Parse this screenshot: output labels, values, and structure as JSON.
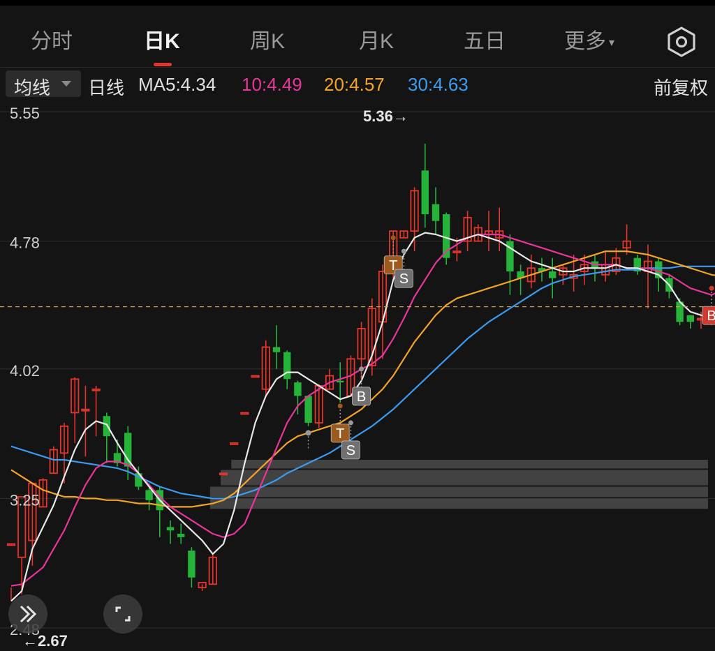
{
  "tabs": [
    {
      "label": "分时",
      "active": false
    },
    {
      "label": "日K",
      "active": true
    },
    {
      "label": "周K",
      "active": false
    },
    {
      "label": "月K",
      "active": false
    },
    {
      "label": "五日",
      "active": false
    },
    {
      "label": "更多",
      "active": false
    }
  ],
  "more_caret": "▾",
  "icons": {
    "settings": "hexagon-gear-icon",
    "expand": "double-chevron-right-icon",
    "fullscreen": "fullscreen-corners-icon"
  },
  "ma_bar": {
    "selector_label": "均线",
    "period_label": "日线",
    "ma5": "MA5:4.34",
    "ma10": "10:4.49",
    "ma20": "20:4.57",
    "ma30": "30:4.63",
    "adjust_label": "前复权"
  },
  "colors": {
    "up": "#e5362b",
    "down": "#25b339",
    "ma5": "#e8e8e8",
    "ma10": "#e8359a",
    "ma20": "#f3a426",
    "ma30": "#3a9bef",
    "current_price_line": "#c9a24a",
    "marker_T": "#9c5a1e",
    "marker_S": "#707070",
    "marker_B_gray": "#707070",
    "marker_B_red": "#d23a30"
  },
  "chart_data": {
    "type": "candlestick",
    "y_axis_labels": [
      "5.55",
      "4.78",
      "4.02",
      "3.25",
      "2.48"
    ],
    "ylim": [
      2.48,
      5.55
    ],
    "high_label": "5.36→",
    "low_label": "←2.67",
    "high_value": 5.36,
    "low_value": 2.67,
    "current_price": 4.39,
    "candles": [
      [
        2.98,
        2.98,
        2.72,
        2.64
      ],
      [
        2.9,
        3.26,
        2.68,
        2.9
      ],
      [
        3.0,
        3.34,
        2.85,
        3.34
      ],
      [
        3.2,
        3.36,
        3.2,
        3.37
      ],
      [
        3.4,
        3.54,
        3.4,
        3.56
      ],
      [
        3.52,
        3.68,
        3.34,
        3.7
      ],
      [
        3.76,
        3.96,
        3.58,
        3.97
      ],
      [
        3.78,
        3.78,
        3.5,
        3.92
      ],
      [
        3.9,
        3.9,
        3.62,
        3.92
      ],
      [
        3.74,
        3.62,
        3.46,
        3.76
      ],
      [
        3.52,
        3.46,
        3.44,
        3.6
      ],
      [
        3.64,
        3.44,
        3.36,
        3.68
      ],
      [
        3.4,
        3.32,
        3.3,
        3.44
      ],
      [
        3.3,
        3.24,
        3.18,
        3.34
      ],
      [
        3.3,
        3.18,
        3.02,
        3.32
      ],
      [
        3.08,
        3.06,
        2.98,
        3.12
      ],
      [
        3.04,
        3.02,
        2.98,
        3.1
      ],
      [
        2.94,
        2.78,
        2.72,
        2.96
      ],
      [
        2.72,
        2.75,
        2.7,
        2.74
      ],
      [
        2.74,
        2.9,
        2.74,
        2.92
      ],
      [
        3.4,
        3.4,
        3.4,
        3.4
      ],
      [
        3.58,
        3.58,
        3.58,
        3.58
      ],
      [
        3.76,
        3.76,
        3.76,
        3.76
      ],
      [
        3.98,
        3.98,
        3.98,
        3.98
      ],
      [
        3.9,
        4.15,
        3.86,
        4.19
      ],
      [
        4.15,
        4.12,
        4.02,
        4.28
      ],
      [
        4.12,
        3.96,
        3.9,
        4.13
      ],
      [
        3.94,
        3.86,
        3.75,
        3.95
      ],
      [
        3.86,
        3.7,
        3.68,
        3.86
      ],
      [
        3.7,
        3.92,
        3.67,
        3.93
      ],
      [
        3.9,
        3.98,
        3.9,
        4.02
      ],
      [
        3.95,
        3.94,
        3.82,
        4.06
      ],
      [
        3.86,
        4.08,
        3.86,
        4.1
      ],
      [
        4.08,
        4.26,
        3.96,
        4.3
      ],
      [
        4.04,
        4.38,
        3.98,
        4.44
      ],
      [
        4.3,
        4.6,
        4.08,
        4.64
      ],
      [
        4.6,
        4.84,
        4.56,
        4.84
      ],
      [
        4.8,
        4.84,
        4.8,
        4.84
      ],
      [
        4.84,
        5.08,
        4.72,
        5.1
      ],
      [
        5.2,
        4.94,
        4.86,
        5.36
      ],
      [
        5.0,
        4.9,
        4.82,
        5.1
      ],
      [
        4.94,
        4.68,
        4.64,
        4.95
      ],
      [
        4.72,
        4.72,
        4.66,
        4.8
      ],
      [
        4.78,
        4.92,
        4.72,
        4.96
      ],
      [
        4.78,
        4.86,
        4.78,
        4.88
      ],
      [
        4.82,
        4.84,
        4.72,
        4.96
      ],
      [
        4.8,
        4.84,
        4.72,
        4.98
      ],
      [
        4.78,
        4.6,
        4.46,
        4.82
      ],
      [
        4.6,
        4.56,
        4.46,
        4.64
      ],
      [
        4.54,
        4.62,
        4.5,
        4.7
      ],
      [
        4.62,
        4.6,
        4.54,
        4.68
      ],
      [
        4.6,
        4.56,
        4.44,
        4.68
      ],
      [
        4.58,
        4.62,
        4.52,
        4.64
      ],
      [
        4.56,
        4.58,
        4.48,
        4.7
      ],
      [
        4.6,
        4.64,
        4.52,
        4.7
      ],
      [
        4.66,
        4.62,
        4.54,
        4.7
      ],
      [
        4.58,
        4.64,
        4.54,
        4.72
      ],
      [
        4.6,
        4.68,
        4.58,
        4.74
      ],
      [
        4.74,
        4.78,
        4.7,
        4.88
      ],
      [
        4.68,
        4.6,
        4.58,
        4.7
      ],
      [
        4.6,
        4.66,
        4.38,
        4.76
      ],
      [
        4.66,
        4.56,
        4.48,
        4.68
      ],
      [
        4.56,
        4.48,
        4.44,
        4.58
      ],
      [
        4.42,
        4.3,
        4.28,
        4.44
      ],
      [
        4.34,
        4.3,
        4.26,
        4.34
      ],
      [
        4.32,
        4.32,
        4.26,
        4.36
      ],
      [
        4.3,
        4.34,
        4.28,
        4.36
      ],
      [
        4.28,
        4.34,
        4.24,
        4.44
      ]
    ],
    "ma5": [
      2.64,
      2.7,
      2.95,
      3.08,
      3.21,
      3.38,
      3.54,
      3.66,
      3.71,
      3.69,
      3.58,
      3.48,
      3.4,
      3.32,
      3.24,
      3.18,
      3.12,
      3.06,
      3.0,
      2.92,
      2.98,
      3.18,
      3.46,
      3.7,
      3.86,
      3.96,
      4.0,
      4.0,
      3.96,
      3.92,
      3.88,
      3.84,
      3.86,
      3.95,
      4.1,
      4.3,
      4.55,
      4.7,
      4.8,
      4.83,
      4.82,
      4.8,
      4.78,
      4.8,
      4.82,
      4.8,
      4.78,
      4.74,
      4.7,
      4.66,
      4.64,
      4.62,
      4.6,
      4.6,
      4.62,
      4.62,
      4.62,
      4.64,
      4.62,
      4.62,
      4.6,
      4.58,
      4.52,
      4.42,
      4.36,
      4.34,
      4.32,
      4.34
    ],
    "ma10": [
      2.73,
      2.74,
      2.79,
      2.84,
      2.95,
      3.06,
      3.2,
      3.33,
      3.43,
      3.47,
      3.47,
      3.45,
      3.4,
      3.33,
      3.26,
      3.2,
      3.16,
      3.12,
      3.08,
      3.04,
      3.02,
      3.04,
      3.1,
      3.25,
      3.4,
      3.55,
      3.7,
      3.8,
      3.86,
      3.9,
      3.94,
      3.96,
      3.98,
      4.02,
      4.05,
      4.1,
      4.2,
      4.32,
      4.45,
      4.55,
      4.65,
      4.72,
      4.76,
      4.8,
      4.82,
      4.82,
      4.82,
      4.8,
      4.78,
      4.76,
      4.74,
      4.72,
      4.7,
      4.68,
      4.66,
      4.64,
      4.64,
      4.64,
      4.62,
      4.62,
      4.62,
      4.6,
      4.58,
      4.54,
      4.5,
      4.48,
      4.46,
      4.49
    ],
    "ma20": [
      3.42,
      3.38,
      3.34,
      3.3,
      3.28,
      3.26,
      3.26,
      3.25,
      3.25,
      3.24,
      3.24,
      3.23,
      3.22,
      3.22,
      3.21,
      3.2,
      3.2,
      3.2,
      3.21,
      3.22,
      3.24,
      3.28,
      3.34,
      3.4,
      3.46,
      3.52,
      3.58,
      3.62,
      3.64,
      3.66,
      3.68,
      3.7,
      3.74,
      3.78,
      3.84,
      3.9,
      3.98,
      4.08,
      4.18,
      4.26,
      4.34,
      4.4,
      4.44,
      4.46,
      4.48,
      4.5,
      4.52,
      4.54,
      4.56,
      4.58,
      4.6,
      4.62,
      4.64,
      4.66,
      4.68,
      4.7,
      4.72,
      4.72,
      4.72,
      4.71,
      4.7,
      4.68,
      4.66,
      4.64,
      4.62,
      4.6,
      4.58,
      4.57
    ],
    "ma30": [
      3.56,
      3.54,
      3.52,
      3.5,
      3.48,
      3.48,
      3.47,
      3.46,
      3.45,
      3.44,
      3.43,
      3.41,
      3.38,
      3.35,
      3.32,
      3.3,
      3.28,
      3.27,
      3.26,
      3.25,
      3.25,
      3.26,
      3.28,
      3.3,
      3.33,
      3.36,
      3.4,
      3.43,
      3.46,
      3.49,
      3.52,
      3.56,
      3.6,
      3.64,
      3.68,
      3.73,
      3.78,
      3.84,
      3.9,
      3.96,
      4.02,
      4.08,
      4.14,
      4.2,
      4.25,
      4.3,
      4.34,
      4.38,
      4.42,
      4.46,
      4.5,
      4.53,
      4.55,
      4.57,
      4.58,
      4.59,
      4.6,
      4.61,
      4.61,
      4.61,
      4.62,
      4.62,
      4.62,
      4.63,
      4.63,
      4.63,
      4.63,
      4.63
    ],
    "volume_profile": [
      {
        "from": 3.42,
        "to": 3.48,
        "start_index": 21
      },
      {
        "from": 3.32,
        "to": 3.42,
        "start_index": 20
      },
      {
        "from": 3.25,
        "to": 3.32,
        "start_index": 19
      },
      {
        "from": 3.18,
        "to": 3.25,
        "start_index": 19
      }
    ],
    "markers": [
      {
        "index": 36,
        "label": "T",
        "type": "T",
        "anchor_price": 4.8
      },
      {
        "index": 37,
        "label": "S",
        "type": "S",
        "anchor_price": 4.72
      },
      {
        "index": 31,
        "label": "T",
        "type": "T",
        "anchor_price": 3.8
      },
      {
        "index": 32,
        "label": "S",
        "type": "S",
        "anchor_price": 3.7
      },
      {
        "index": 33,
        "label": "B",
        "type": "B_gray",
        "anchor_price": 4.02
      },
      {
        "index": 28,
        "label": "",
        "type": "dot",
        "anchor_price": 3.64
      },
      {
        "index": 66,
        "label": "B",
        "type": "B_red",
        "anchor_price": 4.5
      }
    ]
  }
}
